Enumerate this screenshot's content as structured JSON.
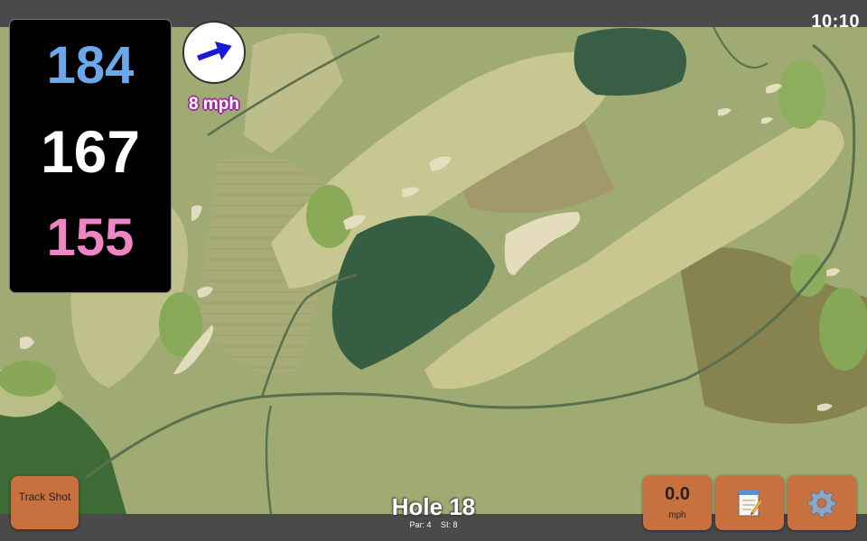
{
  "status_bar": {
    "time": "10:10"
  },
  "distances": {
    "back": "184",
    "middle": "167",
    "front": "155"
  },
  "wind": {
    "speed": "8 mph",
    "icon": "wind-direction-arrow-icon"
  },
  "buttons": {
    "track_shot": "Track Shot",
    "speed_value": "0.0",
    "speed_unit": "mph",
    "notes_icon": "notepad-icon",
    "settings_icon": "gear-icon"
  },
  "hole": {
    "title": "Hole 18",
    "par": "Par: 4",
    "si": "SI: 8"
  },
  "colors": {
    "back": "#6aa8ea",
    "middle": "#ffffff",
    "front": "#ee86c6",
    "button": "#c8713e"
  }
}
